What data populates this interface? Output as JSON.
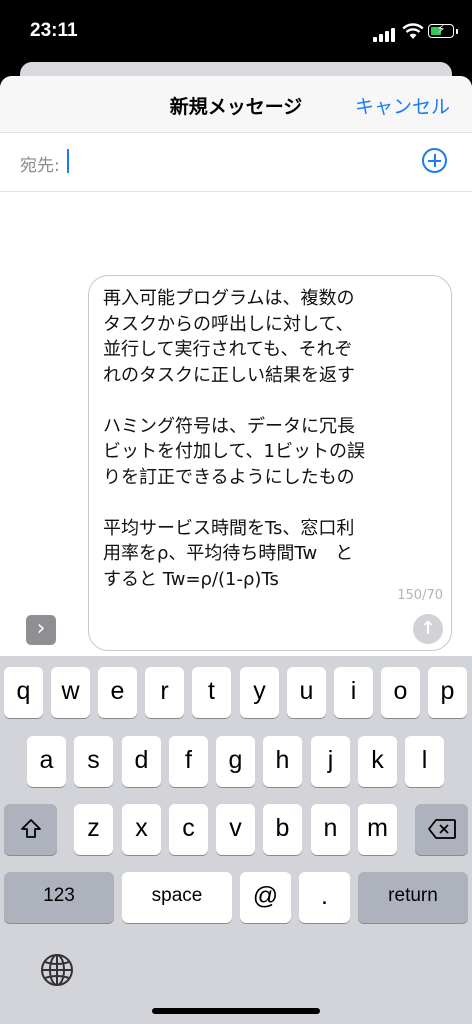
{
  "status_bar": {
    "time": "23:11"
  },
  "nav": {
    "title": "新規メッセージ",
    "cancel": "キャンセル"
  },
  "to_field": {
    "label": "宛先:"
  },
  "message": {
    "paragraphs": [
      "再入可能プログラムは、複数の\nタスクからの呼出しに対して、\n並行して実行されても、それぞ\nれのタスクに正しい結果を返す",
      "ハミング符号は、データに冗長\nビットを付加して、1ビットの誤\nりを訂正できるようにしたもの",
      "平均サービス時間をTs、窓口利\n用率をρ、平均待ち時間Tw　と\nすると Tw=ρ/(1-ρ)Ts"
    ],
    "char_count": "150/70"
  },
  "keyboard": {
    "row1": [
      "q",
      "w",
      "e",
      "r",
      "t",
      "y",
      "u",
      "i",
      "o",
      "p"
    ],
    "row2": [
      "a",
      "s",
      "d",
      "f",
      "g",
      "h",
      "j",
      "k",
      "l"
    ],
    "row3": [
      "z",
      "x",
      "c",
      "v",
      "b",
      "n",
      "m"
    ],
    "numbers_key": "123",
    "space_key": "space",
    "at_key": "@",
    "period_key": ".",
    "return_key": "return"
  }
}
